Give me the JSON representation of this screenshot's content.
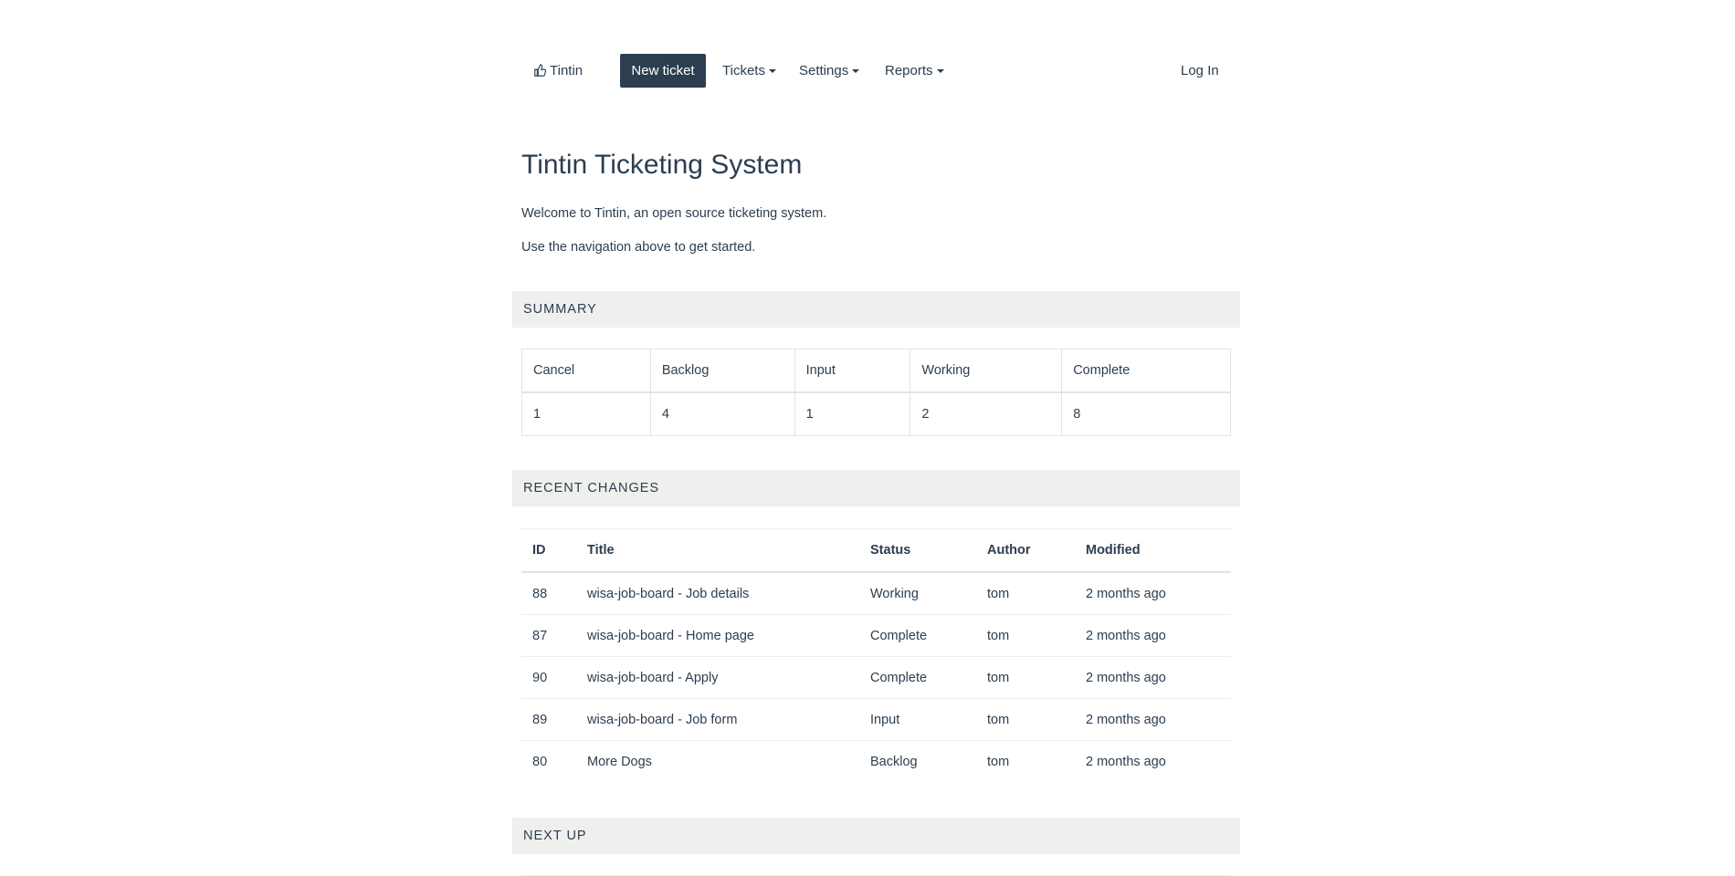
{
  "nav": {
    "brand": "Tintin",
    "new_ticket": "New ticket",
    "tickets": "Tickets",
    "settings": "Settings",
    "reports": "Reports",
    "login": "Log In"
  },
  "page": {
    "title": "Tintin Ticketing System",
    "intro1": "Welcome to Tintin, an open source ticketing system.",
    "intro2": "Use the navigation above to get started."
  },
  "sections": {
    "summary": "SUMMARY",
    "recent": "RECENT CHANGES",
    "next": "NEXT UP"
  },
  "summary": {
    "headers": [
      "Cancel",
      "Backlog",
      "Input",
      "Working",
      "Complete"
    ],
    "values": [
      "1",
      "4",
      "1",
      "2",
      "8"
    ]
  },
  "recent": {
    "headers": [
      "ID",
      "Title",
      "Status",
      "Author",
      "Modified"
    ],
    "rows": [
      [
        "88",
        "wisa-job-board - Job details",
        "Working",
        "tom",
        "2 months ago"
      ],
      [
        "87",
        "wisa-job-board - Home page",
        "Complete",
        "tom",
        "2 months ago"
      ],
      [
        "90",
        "wisa-job-board - Apply",
        "Complete",
        "tom",
        "2 months ago"
      ],
      [
        "89",
        "wisa-job-board - Job form",
        "Input",
        "tom",
        "2 months ago"
      ],
      [
        "80",
        "More Dogs",
        "Backlog",
        "tom",
        "2 months ago"
      ]
    ]
  },
  "colors": {
    "primary": "#2c3e50",
    "section_bg": "#efefed"
  }
}
